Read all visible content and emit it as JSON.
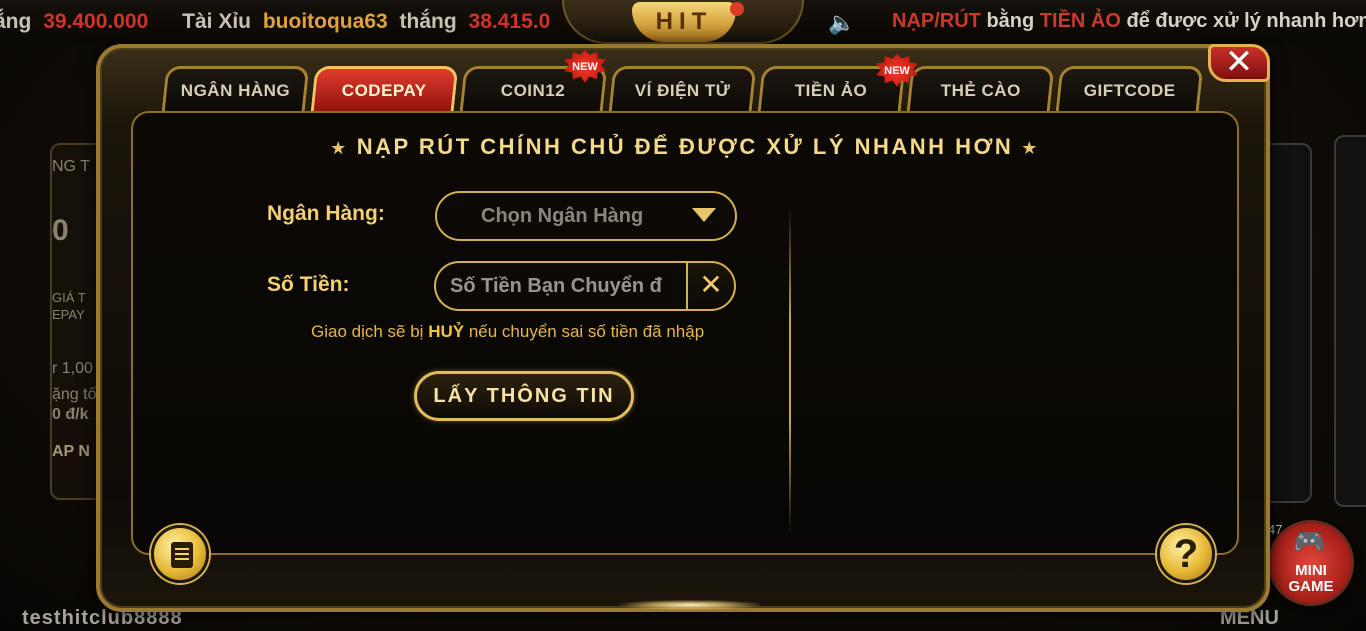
{
  "ticker": {
    "prefix": "ắng",
    "amount1": "39.400.000",
    "game": "Tài Xỉu",
    "user": "buoitoqua63",
    "win_word": "thắng",
    "amount2": "38.415.0"
  },
  "logo_text": "HIT",
  "promo": {
    "part1": "NẠP/RÚT",
    "part2": "bằng",
    "part3": "TIỀN ẢO",
    "part4": "để được xử lý nhanh hơn"
  },
  "background": {
    "left_lines": [
      "NG T",
      "0",
      "GIÁ T",
      "EPAY",
      "r 1,00",
      "ặng tố",
      "0 đ/k",
      "AP N"
    ],
    "username": "testhitclub8888",
    "menu_label": "MENU",
    "mini_game_line1": "MINI",
    "mini_game_line2": "GAME",
    "mini_game_badge": "47"
  },
  "modal": {
    "close_label": "✕",
    "tabs": [
      {
        "label": "NGÂN HÀNG",
        "active": false,
        "new": false
      },
      {
        "label": "CODEPAY",
        "active": true,
        "new": false
      },
      {
        "label": "COIN12",
        "active": false,
        "new": true
      },
      {
        "label": "VÍ ĐIỆN TỬ",
        "active": false,
        "new": false
      },
      {
        "label": "TIỀN ẢO",
        "active": false,
        "new": true
      },
      {
        "label": "THẺ CÀO",
        "active": false,
        "new": false
      },
      {
        "label": "GIFTCODE",
        "active": false,
        "new": false
      }
    ],
    "new_badge": "NEW",
    "title": "NẠP RÚT CHÍNH CHỦ ĐỂ ĐƯỢC XỬ LÝ NHANH HƠN",
    "bank_label": "Ngân Hàng:",
    "bank_select_value": "Chọn Ngân Hàng",
    "amount_label": "Số Tiền:",
    "amount_placeholder": "Số Tiền Bạn Chuyển đ",
    "clear_label": "✕",
    "warning_before": "Giao dịch sẽ bị",
    "warning_strong": "HUỶ",
    "warning_after": "nếu chuyển sai số tiền đã nhập",
    "fetch_button": "LẤY THÔNG TIN",
    "help_label": "?"
  },
  "colors": {
    "accent_gold": "#d4af50",
    "active_tab_red": "#c8261b",
    "title_gold": "#f5d98a"
  }
}
